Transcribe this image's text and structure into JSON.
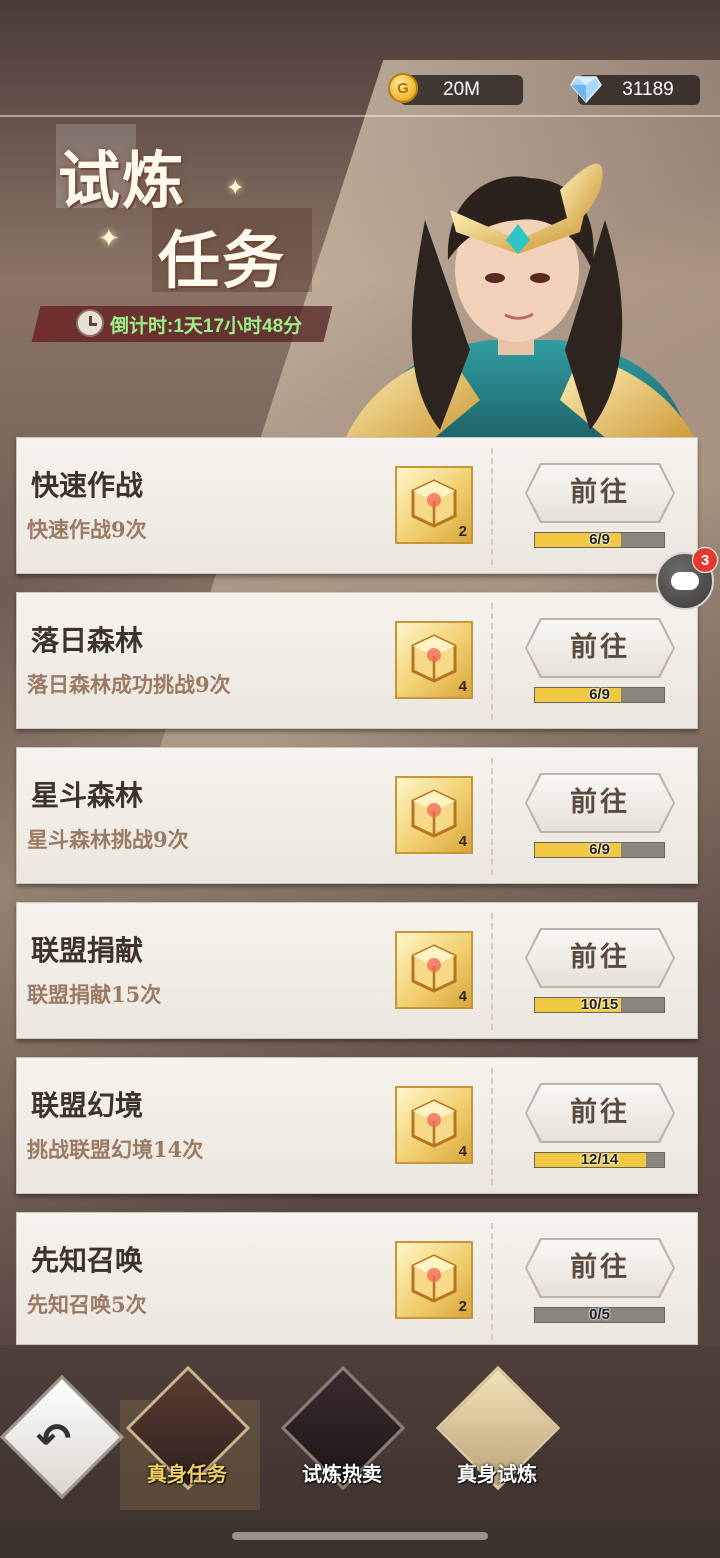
{
  "resources": {
    "gold": {
      "value": "20M",
      "icon": "gold-coin-icon"
    },
    "gems": {
      "value": "31189",
      "icon": "diamond-icon"
    }
  },
  "header": {
    "title_line1": "试炼",
    "title_line2": "任务",
    "countdown": "倒计时:1天17小时48分"
  },
  "tasks": [
    {
      "title": "快速作战",
      "desc": "快速作战9次",
      "reward_count": "2",
      "button": "前往",
      "progress_text": "6/9",
      "progress": 0.6667
    },
    {
      "title": "落日森林",
      "desc": "落日森林成功挑战9次",
      "reward_count": "4",
      "button": "前往",
      "progress_text": "6/9",
      "progress": 0.6667
    },
    {
      "title": "星斗森林",
      "desc": "星斗森林挑战9次",
      "reward_count": "4",
      "button": "前往",
      "progress_text": "6/9",
      "progress": 0.6667
    },
    {
      "title": "联盟捐献",
      "desc": "联盟捐献15次",
      "reward_count": "4",
      "button": "前往",
      "progress_text": "10/15",
      "progress": 0.6667
    },
    {
      "title": "联盟幻境",
      "desc": "挑战联盟幻境14次",
      "reward_count": "4",
      "button": "前往",
      "progress_text": "12/14",
      "progress": 0.857
    },
    {
      "title": "先知召唤",
      "desc": "先知召唤5次",
      "reward_count": "2",
      "button": "前往",
      "progress_text": "0/5",
      "progress": 0
    }
  ],
  "chat": {
    "badge": "3"
  },
  "nav": {
    "tabs": [
      {
        "label": "真身任务",
        "active": true
      },
      {
        "label": "试炼热卖",
        "active": false
      },
      {
        "label": "真身试炼",
        "active": false
      }
    ]
  },
  "colors": {
    "progress_fill": "#f0c842",
    "countdown_text": "#9ef08a",
    "badge": "#e23b2e"
  }
}
